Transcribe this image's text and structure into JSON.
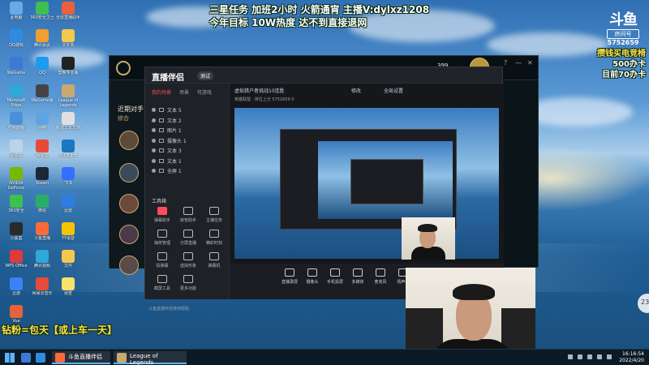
{
  "overlay": {
    "top_line1": "三星任务  加班2小时   火箭通宵   主播V:dylxz1208",
    "top_line2": "今年目标   10W热度   达不到直接退网",
    "right_line1": "攒钱买电竞椅",
    "right_line2": "500办卡",
    "right_line3": "目前70办卡",
    "bottom_line": "钻粉=包天【或上车一天】",
    "logo_mark": "斗鱼",
    "room_label": "房间号",
    "room_number": "5752659",
    "side_badge": "23"
  },
  "desktop_icons": [
    {
      "label": "此电脑",
      "color": "#6aa9e8"
    },
    {
      "label": "360安全卫士",
      "color": "#3fbf4f"
    },
    {
      "label": "全屏直播助手",
      "color": "#e8623b"
    },
    {
      "label": "QQ游戏",
      "color": "#2f8be0"
    },
    {
      "label": "腾讯会议",
      "color": "#f0a030"
    },
    {
      "label": "文件夹",
      "color": "#f2c94c"
    },
    {
      "label": "WeGame",
      "color": "#3a7bd5"
    },
    {
      "label": "QQ",
      "color": "#1d9bf0"
    },
    {
      "label": "剪映专业版",
      "color": "#222222"
    },
    {
      "label": "Microsoft Edge",
      "color": "#2fa7d9"
    },
    {
      "label": "WeGame版",
      "color": "#444444"
    },
    {
      "label": "League of Legends",
      "color": "#c8aa6e"
    },
    {
      "label": "控制面板",
      "color": "#4a90d9"
    },
    {
      "label": "网络",
      "color": "#5fa4e0"
    },
    {
      "label": "新建文本文档",
      "color": "#e0e0e0"
    },
    {
      "label": "回收站",
      "color": "#bcd2e8"
    },
    {
      "label": "网易云",
      "color": "#e84a3a"
    },
    {
      "label": "UU加速器",
      "color": "#1a78c2"
    },
    {
      "label": "NVIDIA GeForce",
      "color": "#76b900"
    },
    {
      "label": "Steam",
      "color": "#1b2838"
    },
    {
      "label": "飞书",
      "color": "#3370ff"
    },
    {
      "label": "360安全",
      "color": "#3fbf4f"
    },
    {
      "label": "微信",
      "color": "#2aae67"
    },
    {
      "label": "迅雷",
      "color": "#2f7de0"
    },
    {
      "label": "小黑盒",
      "color": "#2a2a2a"
    },
    {
      "label": "斗鱼直播",
      "color": "#ff6a3a"
    },
    {
      "label": "YY语音",
      "color": "#f5c400"
    },
    {
      "label": "WPS Office",
      "color": "#e03a3a"
    },
    {
      "label": "腾讯视频",
      "color": "#2fa7d9"
    },
    {
      "label": "文件",
      "color": "#f2c94c"
    },
    {
      "label": "迅游",
      "color": "#3b82f6"
    },
    {
      "label": "网易云音乐",
      "color": "#e84a3a"
    },
    {
      "label": "便签",
      "color": "#f5e36b"
    },
    {
      "label": "Vue",
      "color": "#e8623b"
    }
  ],
  "lol": {
    "side_title": "近期对手",
    "side_tab": "综合",
    "currency": "399",
    "window_controls": [
      "?",
      "—",
      "✕"
    ]
  },
  "zb": {
    "app_name": "直播伴侣",
    "version_badge": "测试",
    "tabs": [
      "我的场景",
      "场景",
      "可游戏"
    ],
    "sources": [
      "文本 5",
      "文本 2",
      "图片 1",
      "摄像头 1",
      "文本 3",
      "文本 1",
      "全屏 1"
    ],
    "tools_label": "工具箱",
    "tools": [
      "弹幕助手",
      "房管助手",
      "主播任务",
      "抽奖管理",
      "分屏直播",
      "精彩时刻",
      "投弹幕",
      "虚拟形象",
      "弹幕机",
      "截屏工具",
      "更多功能"
    ],
    "footer": "斗鱼直播伴侣使用帮助",
    "stream_title": "虚拟猎户者挑战10连胜",
    "stream_label": "修改",
    "category": "全局设置",
    "info_line": "英雄联盟 · 排位上分    5752659    0",
    "bottom_buttons": [
      "直播录屏",
      "摄像头",
      "手机投屏",
      "多媒体",
      "麦克风",
      "扬声器"
    ]
  },
  "taskbar": {
    "apps": [
      "斗鱼直播伴侣",
      "League of Legends"
    ],
    "time": "16:16:54",
    "date": "2022/4/20"
  },
  "colors": {
    "accent_red": "#ff4c5c",
    "overlay_yellow": "#ffe14a",
    "lol_gold": "#c8aa6e"
  }
}
